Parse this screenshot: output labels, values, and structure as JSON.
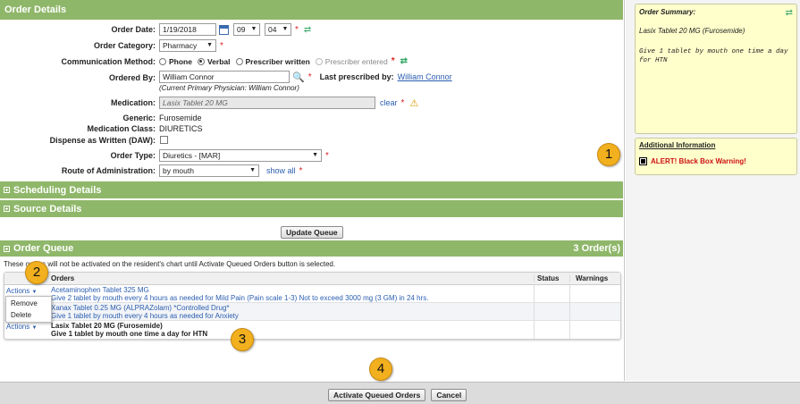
{
  "order_details": {
    "title": "Order Details",
    "order_date_label": "Order Date:",
    "order_date_value": "1/19/2018",
    "hour_value": "09",
    "minute_value": "04",
    "order_category_label": "Order Category:",
    "order_category_value": "Pharmacy",
    "communication_label": "Communication Method:",
    "comm_options": [
      "Phone",
      "Verbal",
      "Prescriber written",
      "Prescriber entered"
    ],
    "comm_selected": "Verbal",
    "ordered_by_label": "Ordered By:",
    "ordered_by_value": "William Connor",
    "current_physician_note": "(Current Primary Physician:  William Connor)",
    "last_prescribed_label": "Last prescribed by:",
    "last_prescribed_value": "William Connor",
    "medication_label": "Medication:",
    "medication_value": "Lasix Tablet 20 MG",
    "clear_label": "clear",
    "generic_label": "Generic:",
    "generic_value": "Furosemide",
    "med_class_label": "Medication Class:",
    "med_class_value": "DIURETICS",
    "daw_label": "Dispense as Written (DAW):",
    "order_type_label": "Order Type:",
    "order_type_value": "Diuretics - [MAR]",
    "route_label": "Route of Administration:",
    "route_value": "by mouth",
    "show_all_label": "show all",
    "required_mark": "*"
  },
  "sections": {
    "scheduling": "Scheduling Details",
    "source": "Source Details"
  },
  "update_queue_label": "Update Queue",
  "order_queue": {
    "title": "Order Queue",
    "count": "3 Order(s)",
    "note": "These orders will not be activated on the resident's chart until Activate Queued Orders button is selected.",
    "columns": [
      "Orders",
      "Status",
      "Warnings"
    ],
    "actions_label": "Actions",
    "rows": [
      {
        "name": "Acetaminophen Tablet 325 MG",
        "detail": "Give 2 tablet by mouth every 4 hours as needed for Mild Pain (Pain scale 1-3) Not to exceed 3000 mg (3 GM) in 24 hrs."
      },
      {
        "name": "Xanax Tablet 0.25 MG (ALPRAZolam) *Controlled Drug*",
        "detail": "Give 1 tablet by mouth every 4 hours as needed for Anxiety"
      },
      {
        "name": "Lasix Tablet 20 MG (Furosemide)",
        "detail": "Give 1 tablet by mouth one time a day for HTN"
      }
    ],
    "menu": [
      "Remove",
      "Delete"
    ]
  },
  "summary": {
    "title": "Order Summary:",
    "medication": "Lasix Tablet 20 MG (Furosemide)",
    "instructions": "Give 1 tablet by mouth one time a day for HTN"
  },
  "additional": {
    "title": "Additional Information",
    "alert": "ALERT! Black Box Warning!"
  },
  "footer": {
    "activate_label": "Activate Queued Orders",
    "cancel_label": "Cancel"
  },
  "badges": [
    "1",
    "2",
    "3",
    "4"
  ],
  "colors": {
    "header_green": "#8fb76a",
    "link_blue": "#2a5db0",
    "alert_red": "#cc1111",
    "badge_orange": "#f2b01e"
  }
}
